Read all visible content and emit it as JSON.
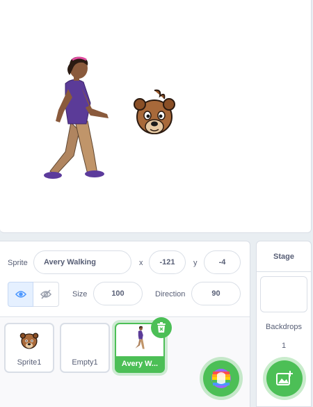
{
  "sprite_info": {
    "sprite_label": "Sprite",
    "sprite_name": "Avery Walking",
    "x_label": "x",
    "x_value": "-121",
    "y_label": "y",
    "y_value": "-4",
    "size_label": "Size",
    "size_value": "100",
    "direction_label": "Direction",
    "direction_value": "90",
    "visible": true
  },
  "sprite_list": [
    {
      "name": "Sprite1",
      "icon": "bear-sprite-icon",
      "selected": false
    },
    {
      "name": "Empty1",
      "icon": "empty",
      "selected": false
    },
    {
      "name": "Avery W...",
      "icon": "avery-sprite-icon",
      "selected": true
    }
  ],
  "stage_pane": {
    "title": "Stage",
    "backdrops_label": "Backdrops",
    "backdrops_count": "1"
  },
  "colors": {
    "accent_green": "#4cbf56",
    "text": "#575e75",
    "border": "#d9dee6",
    "visible_blue": "#4c97ff"
  }
}
